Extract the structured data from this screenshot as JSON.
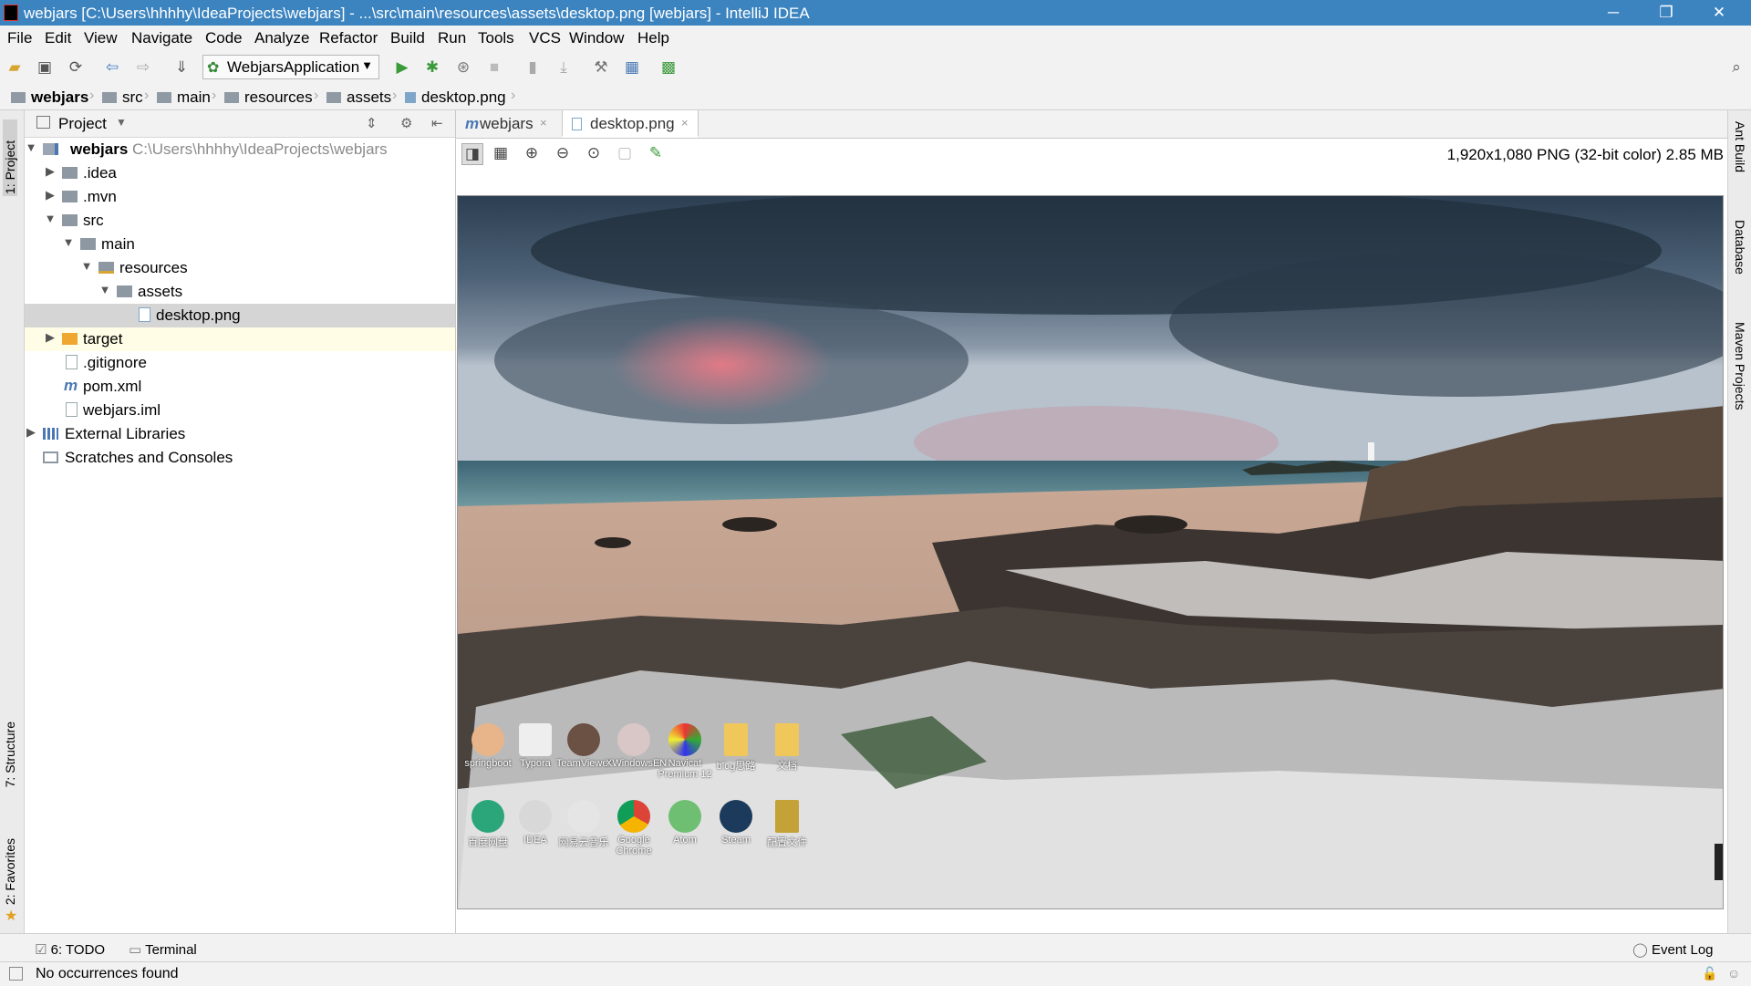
{
  "window": {
    "title": "webjars [C:\\Users\\hhhhy\\IdeaProjects\\webjars] - ...\\src\\main\\resources\\assets\\desktop.png [webjars] - IntelliJ IDEA",
    "minimize": "─",
    "restore": "❐",
    "close": "✕"
  },
  "menu": [
    "File",
    "Edit",
    "View",
    "Navigate",
    "Code",
    "Analyze",
    "Refactor",
    "Build",
    "Run",
    "Tools",
    "VCS",
    "Window",
    "Help"
  ],
  "toolbar": {
    "run_config": "WebjarsApplication"
  },
  "breadcrumb": [
    "webjars",
    "src",
    "main",
    "resources",
    "assets",
    "desktop.png"
  ],
  "left_tool_tabs": [
    "1: Project",
    "7: Structure",
    "2: Favorites"
  ],
  "right_tool_tabs": [
    "Ant Build",
    "Database",
    "Maven Projects"
  ],
  "project_panel": {
    "title": "Project",
    "tree": [
      {
        "label": "webjars",
        "path": "C:\\Users\\hhhhy\\IdeaProjects\\webjars",
        "arrow": "▼"
      },
      {
        "label": ".idea",
        "arrow": "▶"
      },
      {
        "label": ".mvn",
        "arrow": "▶"
      },
      {
        "label": "src",
        "arrow": "▼"
      },
      {
        "label": "main",
        "arrow": "▼"
      },
      {
        "label": "resources",
        "arrow": "▼"
      },
      {
        "label": "assets",
        "arrow": "▼"
      },
      {
        "label": "desktop.png",
        "arrow": ""
      },
      {
        "label": "target",
        "arrow": "▶"
      },
      {
        "label": ".gitignore",
        "arrow": ""
      },
      {
        "label": "pom.xml",
        "arrow": ""
      },
      {
        "label": "webjars.iml",
        "arrow": ""
      },
      {
        "label": "External Libraries",
        "arrow": "▶"
      },
      {
        "label": "Scratches and Consoles",
        "arrow": ""
      }
    ]
  },
  "editor_tabs": [
    {
      "label": "webjars",
      "icon": "m",
      "close": "×"
    },
    {
      "label": "desktop.png",
      "icon": "",
      "close": "×"
    }
  ],
  "image_info": "1,920x1,080 PNG (32-bit color) 2.85 MB",
  "desktop_icons": [
    {
      "label": "springboot"
    },
    {
      "label": "Typora"
    },
    {
      "label": "TeamViewer"
    },
    {
      "label": "XWindowsEN"
    },
    {
      "label": "Navicat Premium 12"
    },
    {
      "label": "blog思路"
    },
    {
      "label": "文档"
    },
    {
      "label": "百度网盘"
    },
    {
      "label": "IDEA"
    },
    {
      "label": "网易云音乐"
    },
    {
      "label": "Google Chrome"
    },
    {
      "label": "Atom"
    },
    {
      "label": "Steam"
    },
    {
      "label": "配置文件"
    }
  ],
  "bottom_tools": {
    "todo": "6: TODO",
    "terminal": "Terminal",
    "event_log": "Event Log"
  },
  "status": {
    "text": "No occurrences found"
  },
  "colors": {
    "titlebar": "#3c84c0",
    "selection": "#d5d5d5",
    "highlight_row": "#fffde6",
    "run_green": "#3a9a3a"
  }
}
